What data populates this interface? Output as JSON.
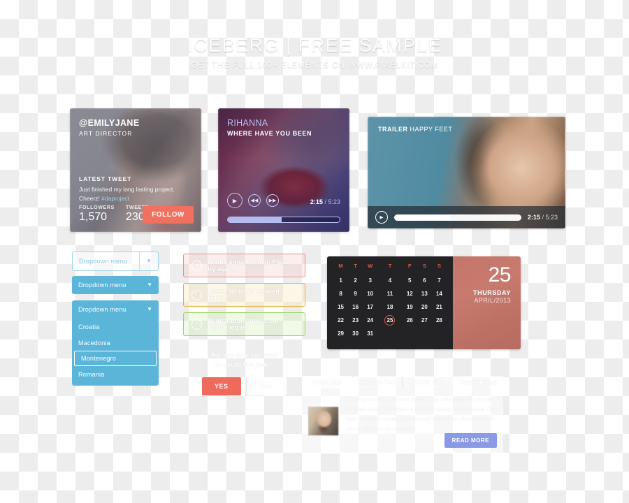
{
  "header": {
    "title": "ICEBERG | FREE SAMPLE",
    "subtitle": "GET THE FULL 100+ ELEMENTS ON WWW.PIXELKIT.COM"
  },
  "profile_card": {
    "handle": "@EMILYJANE",
    "role": "ART DIRECTOR",
    "tweet_label": "LATEST TWEET",
    "tweet_text": "Just finished my long lasting project. Cheerz!",
    "tweet_tag": "#daproject",
    "followers_label": "FOLLOWERS",
    "followers_value": "1,570",
    "tweets_label": "TWEETS",
    "tweets_value": "230",
    "follow_label": "FOLLOW",
    "accent_color": "#f1705f"
  },
  "music_card": {
    "artist": "RIHANNA",
    "song": "WHERE HAVE YOU BEEN",
    "play_icon": "play-icon",
    "prev_icon": "rewind-icon",
    "next_icon": "fast-forward-icon",
    "current_time": "2:15",
    "separator": "/",
    "total_time": "5:23",
    "progress_percent": 48,
    "accent_color": "#b3bbef"
  },
  "video_card": {
    "label": "TRAILER",
    "title": "HAPPY FEET",
    "play_icon": "play-icon",
    "current_time": "2:15",
    "separator": "/",
    "total_time": "5:23",
    "progress_percent": 44
  },
  "dropdowns": {
    "outline": {
      "label": "Dropdown menu",
      "chevron": "chevron-down-icon"
    },
    "solid": {
      "label": "Dropdown menu",
      "chevron": "chevron-down-icon"
    },
    "open": {
      "label": "Dropdown menu",
      "chevron": "chevron-down-icon",
      "options": [
        "Croatia",
        "Macedonia",
        "Montenegro",
        "Romania"
      ],
      "selected": "Montenegro"
    },
    "accent_color": "#5ab5d9",
    "outline_color": "#9ad4ea"
  },
  "alerts": [
    {
      "type": "error",
      "icon": "x-icon",
      "message": "Wrong e-mail format. Please try again!",
      "border_color": "#ea8d86"
    },
    {
      "type": "warning",
      "icon": "info-icon",
      "message": "Please fill in all required fields!",
      "border_color": "#e8ac3c"
    },
    {
      "type": "success",
      "icon": "check-icon",
      "message": "Registration successful. Please log in!",
      "border_color": "#9ed45f"
    }
  ],
  "confirm_dialog": {
    "message_line1": "Are you sure you want",
    "message_line2": "to delete this item?",
    "yes_label": "YES",
    "no_label": "NO",
    "yes_color": "#ee6a5b"
  },
  "calendar": {
    "weekdays": [
      "M",
      "T",
      "W",
      "T",
      "F",
      "S",
      "S"
    ],
    "weeks": [
      [
        "1",
        "2",
        "3",
        "4",
        "5",
        "6",
        "7"
      ],
      [
        "8",
        "9",
        "10",
        "11",
        "12",
        "13",
        "14"
      ],
      [
        "15",
        "16",
        "17",
        "18",
        "19",
        "20",
        "21"
      ],
      [
        "22",
        "23",
        "24",
        "25",
        "26",
        "27",
        "28"
      ],
      [
        "29",
        "30",
        "31",
        "",
        "",
        "",
        ""
      ]
    ],
    "today": "25",
    "weekday_color": "#e0574c",
    "background_color": "#232326",
    "date_panel": {
      "day_number": "25",
      "weekday": "THURSDAY",
      "month_year": "APRIL/2013",
      "background_color": "#c4766c"
    }
  },
  "tab_panel": {
    "tabs": [
      "FIRST TAB",
      "SECOND TAB",
      "THIRD TAB",
      "FOURTH TAB"
    ],
    "active_tab": "FIRST TAB",
    "avatar": "avatar-image",
    "body_text": "Lorem ipsum dolor sit amet, consectetur adipisicing elit, sed do eiusmod tempor incididunt ut labore et dolore magna aliqua. Ut enim ad minim veniam, quis nostrud exercitation ullamco laboris nisi ut aliquip ex ea commodo.",
    "read_more_label": "READ MORE",
    "read_more_color": "#8b9ae6"
  }
}
